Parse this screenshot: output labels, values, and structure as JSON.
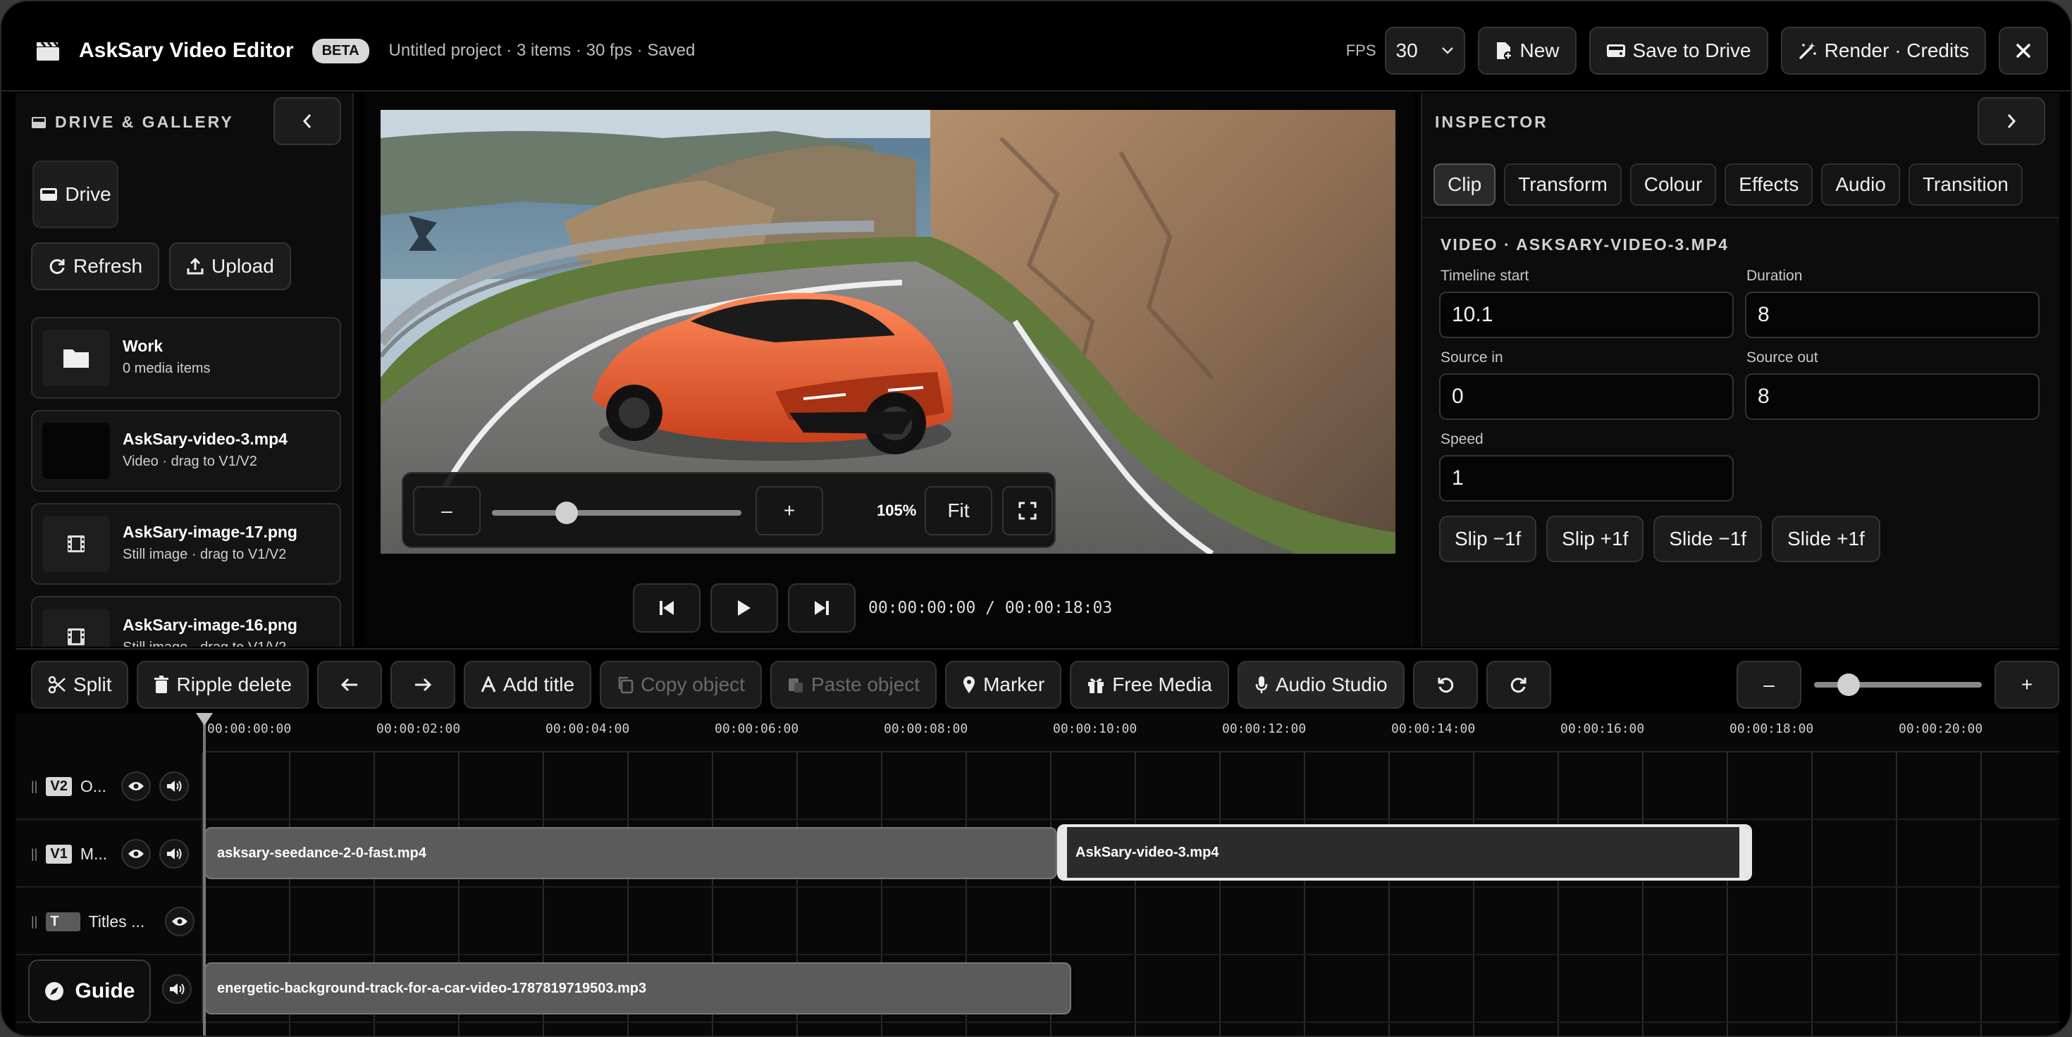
{
  "header": {
    "title": "AskSary Video Editor",
    "badge": "BETA",
    "project_info": "Untitled project · 3 items · 30 fps · Saved",
    "fps_label": "FPS",
    "fps_value": "30",
    "new_label": "New",
    "save_label": "Save to Drive",
    "render_label": "Render · Credits"
  },
  "left_panel": {
    "title": "DRIVE & GALLERY",
    "drive_label": "Drive",
    "refresh_label": "Refresh",
    "upload_label": "Upload",
    "items": [
      {
        "name": "Work",
        "sub": "0 media items",
        "icon": "folder-icon"
      },
      {
        "name": "AskSary-video-3.mp4",
        "sub": "Video · drag to V1/V2",
        "icon": "video-thumbnail"
      },
      {
        "name": "AskSary-image-17.png",
        "sub": "Still image · drag to V1/V2",
        "icon": "film-icon"
      },
      {
        "name": "AskSary-image-16.png",
        "sub": "Still image · drag to V1/V2",
        "icon": "film-icon"
      }
    ]
  },
  "viewer": {
    "zoom_minus": "–",
    "zoom_plus": "+",
    "zoom_level": 0.3,
    "zoom_pct": "105%",
    "fit_label": "Fit",
    "timecode": "00:00:00:00 / 00:00:18:03"
  },
  "inspector": {
    "title": "INSPECTOR",
    "tabs": [
      "Clip",
      "Transform",
      "Colour",
      "Effects",
      "Audio",
      "Transition"
    ],
    "clip_header": "VIDEO · ASKSARY-VIDEO-3.MP4",
    "fields": {
      "timeline_start": {
        "label": "Timeline start",
        "value": "10.1"
      },
      "duration": {
        "label": "Duration",
        "value": "8"
      },
      "source_in": {
        "label": "Source in",
        "value": "0"
      },
      "source_out": {
        "label": "Source out",
        "value": "8"
      },
      "speed": {
        "label": "Speed",
        "value": "1"
      }
    },
    "slip_buttons": [
      "Slip −1f",
      "Slip +1f",
      "Slide −1f",
      "Slide +1f"
    ]
  },
  "toolbar": {
    "split": "Split",
    "ripple_delete": "Ripple delete",
    "add_title": "Add title",
    "copy_object": "Copy object",
    "paste_object": "Paste object",
    "marker": "Marker",
    "free_media": "Free Media",
    "audio_studio": "Audio Studio",
    "zoom_minus": "–",
    "zoom_plus": "+",
    "zoom_level": 0.14
  },
  "timeline": {
    "ticks": [
      "00:00:00:00",
      "00:00:02:00",
      "00:00:04:00",
      "00:00:06:00",
      "00:00:08:00",
      "00:00:10:00",
      "00:00:12:00",
      "00:00:14:00",
      "00:00:16:00",
      "00:00:18:00",
      "00:00:20:00"
    ],
    "tracks": [
      {
        "key": "V2",
        "name": "O..."
      },
      {
        "key": "V1",
        "name": "M..."
      },
      {
        "key": "T",
        "name": "Titles ..."
      },
      {
        "key": "A",
        "name": ""
      }
    ],
    "clips": {
      "v1_a": "asksary-seedance-2-0-fast.mp4",
      "v1_b": "AskSary-video-3.mp4",
      "a1": "energetic-background-track-for-a-car-video-1787819719503.mp3"
    }
  },
  "guide_label": "Guide"
}
